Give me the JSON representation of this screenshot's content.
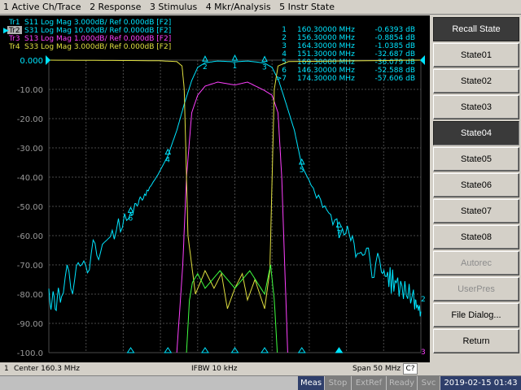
{
  "menu": [
    "1 Active Ch/Trace",
    "2 Response",
    "3 Stimulus",
    "4 Mkr/Analysis",
    "5 Instr State"
  ],
  "traces": [
    {
      "id": "Tr1",
      "text": "S11 Log Mag 3.000dB/ Ref 0.000dB [F2]",
      "color": "#00e5ff"
    },
    {
      "id": "Tr2",
      "text": "S31 Log Mag 10.00dB/ Ref 0.000dB [F2]",
      "color": "#00e5ff",
      "active": true
    },
    {
      "id": "Tr3",
      "text": "S13 Log Mag 1.000dB/ Ref 0.000dB [F2]",
      "color": "#ff40ff"
    },
    {
      "id": "Tr4",
      "text": "S33 Log Mag 3.000dB/ Ref 0.000dB [F2]",
      "color": "#e0e040"
    }
  ],
  "markers": [
    {
      "num": "1",
      "freq": "160.30000 MHz",
      "value": "-0.6393 dB"
    },
    {
      "num": "2",
      "freq": "156.30000 MHz",
      "value": "-0.8854 dB"
    },
    {
      "num": "3",
      "freq": "164.30000 MHz",
      "value": "-1.0385 dB"
    },
    {
      "num": "4",
      "freq": "151.30000 MHz",
      "value": "-32.687 dB"
    },
    {
      "num": "5",
      "freq": "169.30000 MHz",
      "value": "-36.079 dB"
    },
    {
      "num": "6",
      "freq": "146.30000 MHz",
      "value": "-52.588 dB"
    },
    {
      "num": ">7",
      "freq": "174.30000 MHz",
      "value": "-57.606 dB"
    }
  ],
  "y_labels": [
    "0.000",
    "-10.00",
    "-20.00",
    "-30.00",
    "-40.00",
    "-50.00",
    "-60.00",
    "-70.00",
    "-80.00",
    "-90.00",
    "-100.0"
  ],
  "softkeys": {
    "title": "Recall State",
    "items": [
      {
        "label": "State01",
        "state": "normal"
      },
      {
        "label": "State02",
        "state": "normal"
      },
      {
        "label": "State03",
        "state": "normal"
      },
      {
        "label": "State04",
        "state": "active"
      },
      {
        "label": "State05",
        "state": "normal"
      },
      {
        "label": "State06",
        "state": "normal"
      },
      {
        "label": "State07",
        "state": "normal"
      },
      {
        "label": "State08",
        "state": "normal"
      },
      {
        "label": "Autorec",
        "state": "disabled"
      },
      {
        "label": "UserPres",
        "state": "disabled"
      },
      {
        "label": "File Dialog...",
        "state": "normal"
      },
      {
        "label": "Return",
        "state": "normal"
      }
    ]
  },
  "channel": {
    "num": "1",
    "center": "Center 160.3 MHz",
    "ifbw": "IFBW 10 kHz",
    "span": "Span 50 MHz",
    "c2": "C?"
  },
  "status": {
    "meas": "Meas",
    "stop": "Stop",
    "extref": "ExtRef",
    "ready": "Ready",
    "svc": "Svc",
    "datetime": "2019-02-15 01:43"
  },
  "chart_data": {
    "type": "line",
    "x_range_mhz": [
      135.3,
      185.3
    ],
    "ylim": [
      -100,
      0
    ],
    "series": [
      {
        "name": "S31",
        "color": "#00e5ff",
        "x": [
          135.3,
          137,
          140,
          143,
          146.3,
          148,
          150,
          151.3,
          152.5,
          153.5,
          154.5,
          155.3,
          156.3,
          158,
          160.3,
          162,
          164.3,
          165.3,
          166.2,
          167.2,
          168.3,
          169.3,
          171,
          174.3,
          177,
          180,
          182,
          184.3,
          185.3
        ],
        "y": [
          -82,
          -78,
          -70,
          -62,
          -52.6,
          -47,
          -39,
          -32.7,
          -24,
          -15,
          -7,
          -2.5,
          -0.9,
          -0.3,
          -0.6,
          -0.3,
          -1.0,
          -2.5,
          -7,
          -15,
          -24,
          -36.1,
          -45,
          -57.6,
          -65,
          -72,
          -77,
          -82,
          -86
        ]
      },
      {
        "name": "S13",
        "color": "#ff40ff",
        "x": [
          152.5,
          153.3,
          153.8,
          154.5,
          155.3,
          156.3,
          158,
          160.3,
          162,
          164.3,
          165.3,
          166.1,
          166.6,
          167.4
        ],
        "y": [
          -100,
          -70,
          -40,
          -18,
          -12,
          -8.9,
          -7.5,
          -8.5,
          -7.5,
          -10.4,
          -12,
          -18,
          -40,
          -100
        ]
      },
      {
        "name": "S33",
        "color": "#e0e040",
        "x": [
          135.3,
          150,
          152.5,
          153.2,
          153.5,
          154,
          155,
          156.3,
          157.5,
          158.5,
          159.3,
          160.3,
          161.3,
          162,
          163,
          164.3,
          165,
          165.6,
          166.1,
          167.5,
          185.3
        ],
        "y": [
          0,
          -0.2,
          -0.5,
          -2,
          -10,
          -60,
          -80,
          -72,
          -78,
          -73,
          -85,
          -78,
          -73,
          -82,
          -75,
          -85,
          -72,
          -10,
          -2,
          -0.5,
          0
        ]
      },
      {
        "name": "S11",
        "color": "#40ff40",
        "x": [
          153.8,
          154.2,
          154.6,
          155.3,
          156.3,
          158.3,
          160.3,
          162.3,
          164.3,
          165.1,
          165.6,
          166
        ],
        "y": [
          -100,
          -82,
          -76,
          -73,
          -78,
          -72,
          -78,
          -72,
          -80,
          -70,
          -82,
          -100
        ]
      }
    ]
  }
}
